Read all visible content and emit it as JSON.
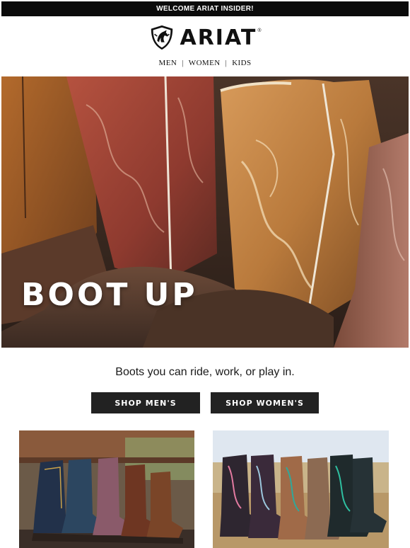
{
  "topbar": {
    "text": "WELCOME ARIAT INSIDER!"
  },
  "brand": {
    "name": "ARIAT",
    "reg": "®",
    "logo_icon": "ariat-horse-shield-icon"
  },
  "nav": {
    "items": [
      {
        "label": "MEN"
      },
      {
        "label": "WOMEN"
      },
      {
        "label": "KIDS"
      }
    ],
    "separator": "|"
  },
  "hero": {
    "title": "BOOT UP"
  },
  "body": {
    "tagline": "Boots you can ride, work, or play in."
  },
  "buttons": {
    "men": "SHOP MEN'S",
    "women": "SHOP WOMEN'S"
  },
  "colors": {
    "topbar_bg": "#0b0b0b",
    "button_bg": "#222222",
    "text": "#111111"
  }
}
